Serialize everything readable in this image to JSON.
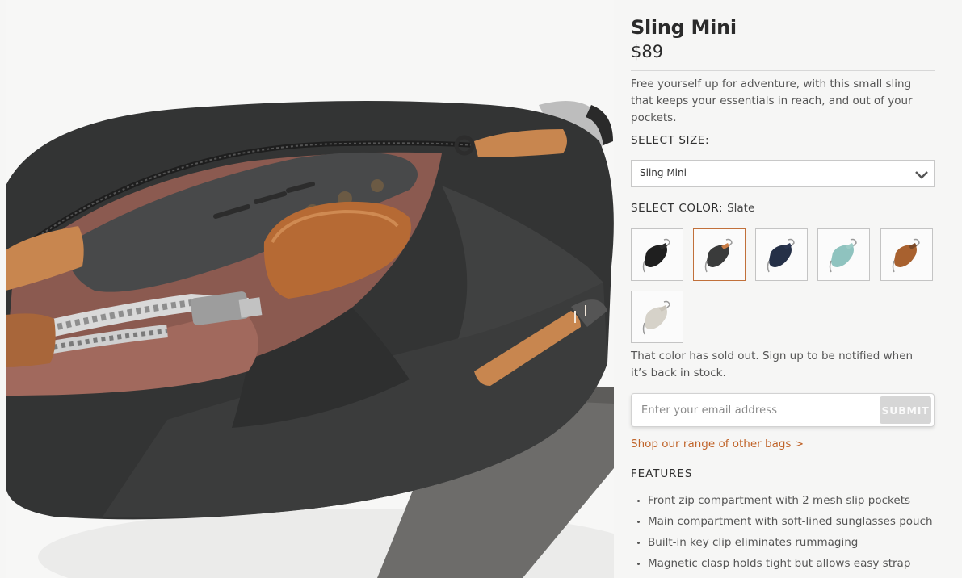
{
  "product": {
    "title": "Sling Mini",
    "price": "$89",
    "description": "Free yourself up for adventure, with this small sling that keeps your essentials in reach, and out of your pockets.",
    "image_alt": "Slate sling mini bag opened showing phone, sunglasses case and cable"
  },
  "size": {
    "label": "SELECT SIZE:",
    "selected": "Sling Mini"
  },
  "color": {
    "label": "SELECT COLOR:",
    "selected": "Slate",
    "swatches": [
      {
        "name": "Black",
        "bag": "#1f1f1f",
        "tab": "#2a2a2a",
        "selected": false
      },
      {
        "name": "Slate",
        "bag": "#3a3b3b",
        "tab": "#c97c45",
        "selected": true
      },
      {
        "name": "Navy",
        "bag": "#253047",
        "tab": "#2b3550",
        "selected": false
      },
      {
        "name": "Teal",
        "bag": "#8fc3bf",
        "tab": "#9ccbc6",
        "selected": false
      },
      {
        "name": "Bronze",
        "bag": "#a8612f",
        "tab": "#7a4826",
        "selected": false
      },
      {
        "name": "Stone",
        "bag": "#d6d2c9",
        "tab": "#c9c4ba",
        "selected": false
      }
    ]
  },
  "soldout": {
    "message": "That color has sold out. Sign up to be notified when it’s back in stock.",
    "email_placeholder": "Enter your email address",
    "submit_label": "SUBMIT"
  },
  "shop_link": "Shop our range of other bags >",
  "features": {
    "title": "FEATURES",
    "items": [
      "Front zip compartment with 2 mesh slip pockets",
      "Main compartment with soft-lined sunglasses pouch",
      "Built-in key clip eliminates rummaging",
      "Magnetic clasp holds tight but allows easy strap"
    ]
  },
  "colors": {
    "accent": "#c0642a",
    "selected_border": "#c1703a",
    "bag_body": "#333434",
    "leather": "#c8864f"
  }
}
